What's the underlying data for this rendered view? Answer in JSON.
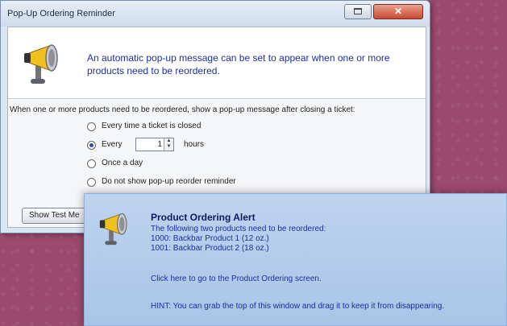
{
  "dialog": {
    "title": "Pop-Up Ordering Reminder",
    "header_text": "An automatic pop-up message can be set to appear when one or more products need to be reordered.",
    "question": "When one or more products need to be reordered, show a pop-up message after closing a ticket:",
    "options": [
      {
        "label": "Every time a ticket is closed",
        "checked": false
      },
      {
        "label": "Every",
        "checked": true
      },
      {
        "label": "Once a day",
        "checked": false
      },
      {
        "label": "Do not show pop-up reorder reminder",
        "checked": false
      }
    ],
    "interval_value": "1",
    "interval_unit": "hours",
    "test_button_label": "Show Test Me"
  },
  "alert": {
    "title": "Product Ordering Alert",
    "intro": "The following two products need to be reordered:",
    "products": [
      "1000: Backbar Product 1 (12 oz.)",
      "1001: Backbar Product 2 (18 oz.)"
    ],
    "link_text": "Click here to go to the Product Ordering screen.",
    "hint": "HINT: You can grab the top of this window and drag it to keep it from disappearing."
  },
  "icons": {
    "megaphone": "megaphone-icon",
    "close": "close-icon",
    "restore": "restore-icon"
  },
  "colors": {
    "background": "#9a4a6c",
    "dialog_text": "#1b2f9c",
    "close_button": "#c94a34",
    "alert_background": "#bdd4ef"
  }
}
